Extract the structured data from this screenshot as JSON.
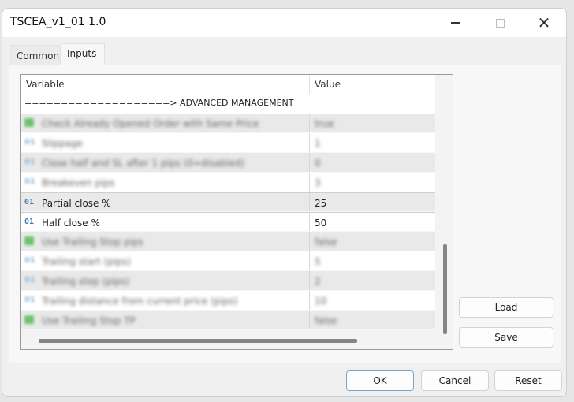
{
  "window": {
    "title": "TSCEA_v1_01 1.0",
    "controls": {
      "minimize": "minimize-icon",
      "maximize": "maximize-icon",
      "close": "close-icon"
    }
  },
  "tabs": [
    {
      "label": "Common",
      "active": false
    },
    {
      "label": "Inputs",
      "active": true
    }
  ],
  "grid": {
    "headers": {
      "variable": "Variable",
      "value": "Value"
    },
    "section_label": "====================> ADVANCED MANAGEMENT",
    "rows": [
      {
        "type": "bool",
        "icon": "bool-icon",
        "name": "Check Already Opened Order with Same Price",
        "value": "true",
        "blurred": true
      },
      {
        "type": "int",
        "icon": "int-icon",
        "name": "Slippage",
        "value": "1",
        "blurred": true
      },
      {
        "type": "int",
        "icon": "int-icon",
        "name": "Close half and SL after 1 pips (0=disabled)",
        "value": "0",
        "blurred": true
      },
      {
        "type": "int",
        "icon": "int-icon",
        "name": "Breakeven pips",
        "value": "3",
        "blurred": true
      },
      {
        "type": "int",
        "icon": "int-icon",
        "icon_text": "01",
        "name": "Partial close %",
        "value": "25",
        "blurred": false
      },
      {
        "type": "int",
        "icon": "int-icon",
        "icon_text": "01",
        "name": "Half close %",
        "value": "50",
        "blurred": false
      },
      {
        "type": "bool",
        "icon": "bool-icon",
        "name": "Use Trailing Stop pips",
        "value": "false",
        "blurred": true
      },
      {
        "type": "int",
        "icon": "int-icon",
        "name": "Trailing start (pips)",
        "value": "5",
        "blurred": true
      },
      {
        "type": "int",
        "icon": "int-icon",
        "name": "Trailing step (pips)",
        "value": "2",
        "blurred": true
      },
      {
        "type": "int",
        "icon": "int-icon",
        "name": "Trailing distance from current price (pips)",
        "value": "10",
        "blurred": true
      },
      {
        "type": "bool",
        "icon": "bool-icon",
        "name": "Use Trailing Stop TP",
        "value": "false",
        "blurred": true
      }
    ]
  },
  "side_buttons": {
    "load": "Load",
    "save": "Save"
  },
  "footer_buttons": {
    "ok": "OK",
    "cancel": "Cancel",
    "reset": "Reset"
  }
}
